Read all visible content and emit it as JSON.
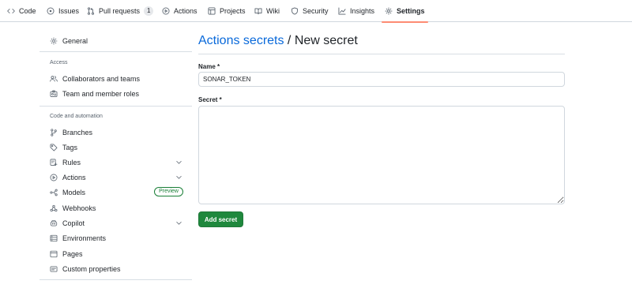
{
  "nav": {
    "tabs": [
      {
        "label": "Code",
        "icon": "code-icon"
      },
      {
        "label": "Issues",
        "icon": "issue-icon"
      },
      {
        "label": "Pull requests",
        "icon": "pull-request-icon",
        "count": "1"
      },
      {
        "label": "Actions",
        "icon": "play-icon"
      },
      {
        "label": "Projects",
        "icon": "table-icon"
      },
      {
        "label": "Wiki",
        "icon": "book-icon"
      },
      {
        "label": "Security",
        "icon": "shield-icon"
      },
      {
        "label": "Insights",
        "icon": "graph-icon"
      },
      {
        "label": "Settings",
        "icon": "gear-icon",
        "active": true
      }
    ],
    "active_underline_color": "#fd8c73"
  },
  "sidebar": {
    "general": "General",
    "access_heading": "Access",
    "access_items": [
      "Collaborators and teams",
      "Team and member roles"
    ],
    "code_heading": "Code and automation",
    "code_items": [
      {
        "label": "Branches",
        "icon": "branch-icon"
      },
      {
        "label": "Tags",
        "icon": "tag-icon"
      },
      {
        "label": "Rules",
        "icon": "rules-icon",
        "expandable": true
      },
      {
        "label": "Actions",
        "icon": "play-icon",
        "expandable": true
      },
      {
        "label": "Models",
        "icon": "models-icon",
        "badge": "Preview"
      },
      {
        "label": "Webhooks",
        "icon": "webhook-icon"
      },
      {
        "label": "Copilot",
        "icon": "copilot-icon",
        "expandable": true
      },
      {
        "label": "Environments",
        "icon": "server-icon"
      },
      {
        "label": "Pages",
        "icon": "browser-icon"
      },
      {
        "label": "Custom properties",
        "icon": "note-icon"
      }
    ]
  },
  "main": {
    "title_link": "Actions secrets",
    "title_rest": " / New secret",
    "name_label": "Name *",
    "name_value": "SONAR_TOKEN",
    "secret_label": "Secret *",
    "secret_value": "",
    "submit_label": "Add secret"
  },
  "colors": {
    "link": "#0969da",
    "primary_button": "#1f883d",
    "preview_badge": "#1a7f37"
  }
}
